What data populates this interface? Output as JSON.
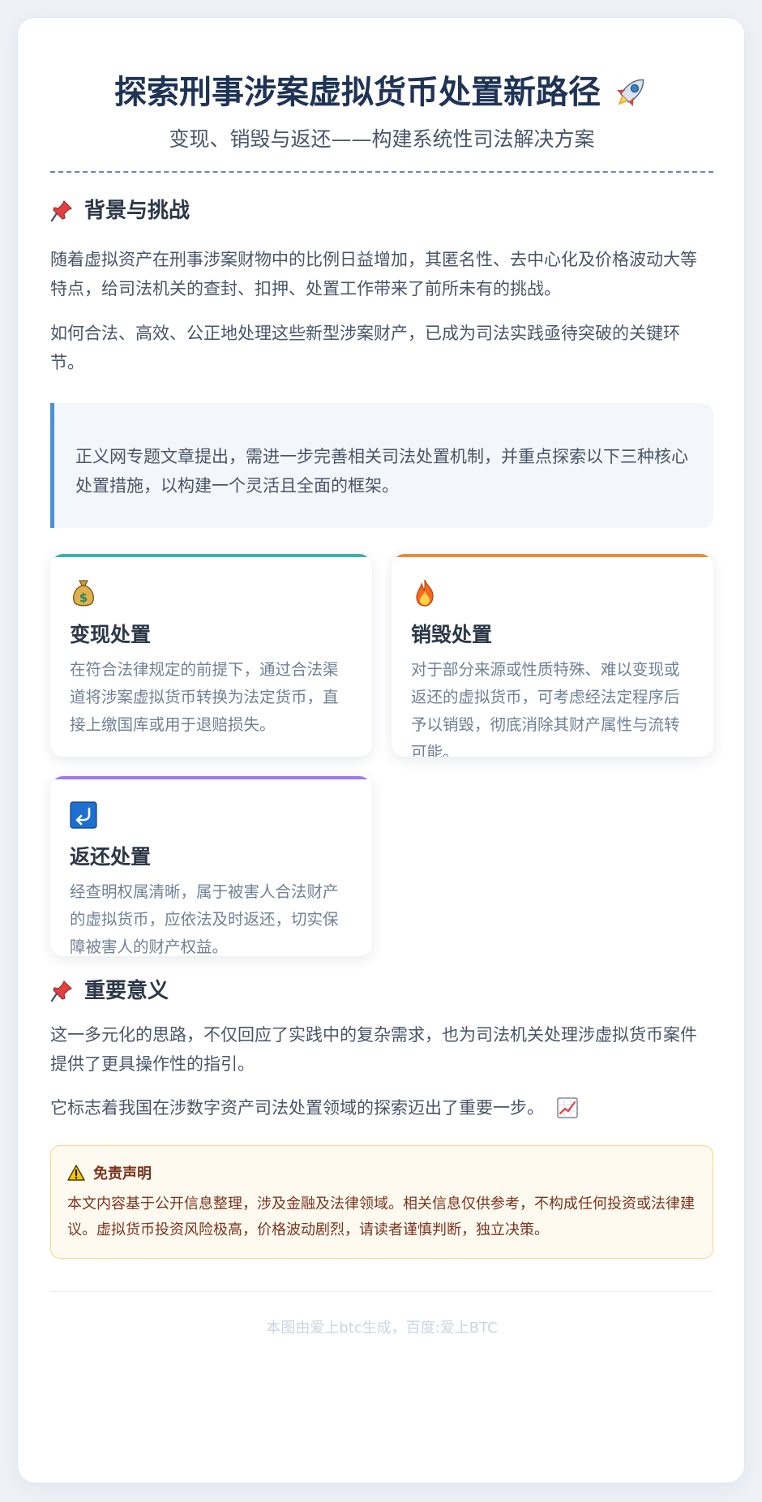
{
  "header": {
    "title": "探索刑事涉案虚拟货币处置新路径",
    "title_icon": "rocket-icon",
    "subtitle": "变现、销毁与返还——构建系统性司法解决方案"
  },
  "background": {
    "heading": "背景与挑战",
    "heading_icon": "pushpin-icon",
    "paragraphs": [
      "随着虚拟资产在刑事涉案财物中的比例日益增加，其匿名性、去中心化及价格波动大等特点，给司法机关的查封、扣押、处置工作带来了前所未有的挑战。",
      "如何合法、高效、公正地处理这些新型涉案财产，已成为司法实践亟待突破的关键环节。"
    ],
    "quote": "正义网专题文章提出，需进一步完善相关司法处置机制，并重点探索以下三种核心处置措施，以构建一个灵活且全面的框架。"
  },
  "methods": [
    {
      "icon": "money-bag-icon",
      "title": "变现处置",
      "desc": "在符合法律规定的前提下，通过合法渠道将涉案虚拟货币转换为法定货币，直接上缴国库或用于退赔损失。",
      "accent": "#38b2ac"
    },
    {
      "icon": "fire-icon",
      "title": "销毁处置",
      "desc": "对于部分来源或性质特殊、难以变现或返还的虚拟货币，可考虑经法定程序后予以销毁，彻底消除其财产属性与流转可能。",
      "accent": "#ed8936"
    },
    {
      "icon": "return-arrow-icon",
      "title": "返还处置",
      "desc": "经查明权属清晰，属于被害人合法财产的虚拟货币，应依法及时返还，切实保障被害人的财产权益。",
      "accent": "#9f7aea"
    }
  ],
  "significance": {
    "heading": "重要意义",
    "heading_icon": "pushpin-icon",
    "paragraphs": [
      "这一多元化的思路，不仅回应了实践中的复杂需求，也为司法机关处理涉虚拟货币案件提供了更具操作性的指引。",
      "它标志着我国在涉数字资产司法处置领域的探索迈出了重要一步。"
    ],
    "trailing_icon": "chart-increasing-icon"
  },
  "disclaimer": {
    "icon": "warning-icon",
    "heading": "免责声明",
    "text": "本文内容基于公开信息整理，涉及金融及法律领域。相关信息仅供参考，不构成任何投资或法律建议。虚拟货币投资风险极高，价格波动剧烈，请读者谨慎判断，独立决策。"
  },
  "footer": {
    "text": "本图由爱上btc生成，百度:爱上BTC"
  }
}
